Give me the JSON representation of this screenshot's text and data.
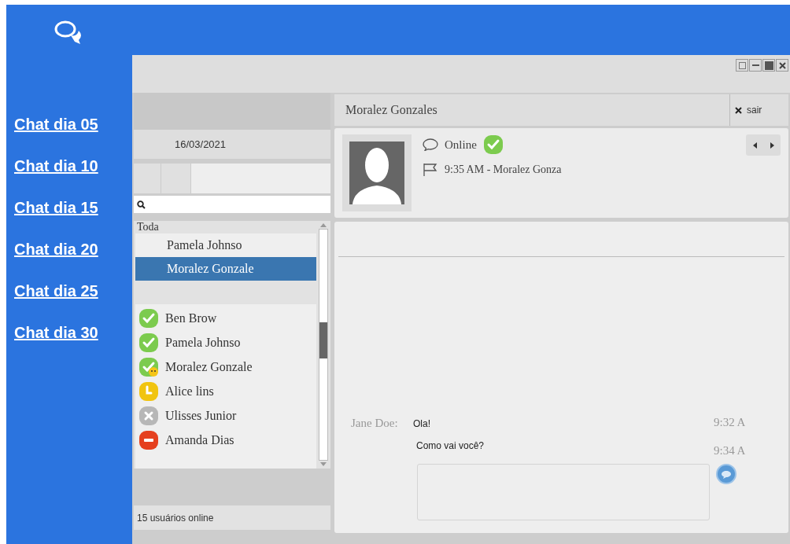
{
  "sidebar": {
    "links": [
      "Chat dia 05",
      "Chat dia 10",
      "Chat dia 15",
      "Chat dia 20",
      "Chat dia 25",
      "Chat dia 30"
    ]
  },
  "left_panel": {
    "date": "16/03/2021",
    "group": {
      "label": "Toda",
      "items": [
        {
          "name": "Pamela Johnso",
          "selected": false
        },
        {
          "name": "Moralez Gonzale",
          "selected": true
        }
      ]
    },
    "contacts": [
      {
        "name": "Ben Brow",
        "kind": "online"
      },
      {
        "name": "Pamela Johnso",
        "kind": "online"
      },
      {
        "name": "Moralez Gonzale",
        "kind": "happy"
      },
      {
        "name": "Alice lins",
        "kind": "away"
      },
      {
        "name": "Ulisses Junior",
        "kind": "offline"
      },
      {
        "name": "Amanda Dias",
        "kind": "busy"
      }
    ],
    "footer": "15 usuários online"
  },
  "chat": {
    "title": "Moralez Gonzales",
    "close_label": "sair",
    "status": "Online",
    "last_seen": "9:35 AM - Moralez Gonza",
    "messages": [
      {
        "sender": "Jane Doe:",
        "text": "Ola!",
        "time": "9:32 A"
      },
      {
        "text": "Como vai você?",
        "time": "9:34 A"
      }
    ]
  }
}
